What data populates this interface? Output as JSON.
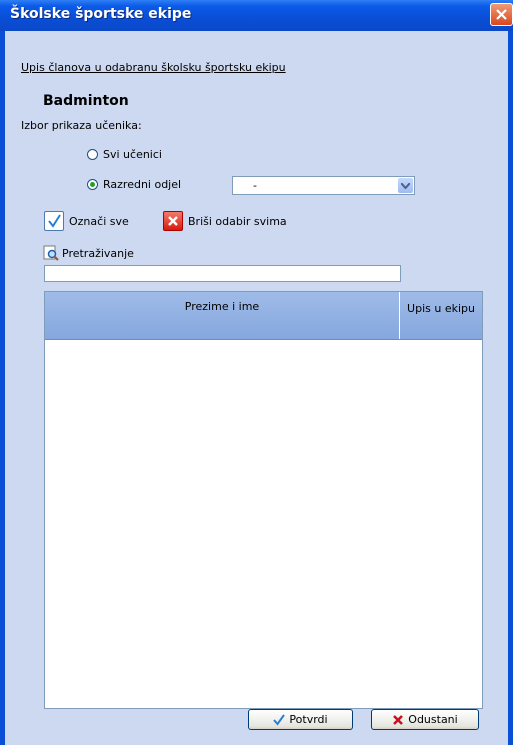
{
  "window": {
    "title": "Školske športske ekipe"
  },
  "form": {
    "heading": "Upis članova u odabranu školsku športsku ekipu",
    "sport": "Badminton",
    "view_label": "Izbor prikaza učenika:",
    "radio_all": "Svi učenici",
    "radio_class": "Razredni odjel",
    "class_select_value": "-",
    "select_all": "Označi sve",
    "clear_all": "Briši odabir svima",
    "search_label": "Pretraživanje",
    "search_value": ""
  },
  "table": {
    "columns": [
      "Prezime i ime",
      "Upis u ekipu"
    ],
    "rows": []
  },
  "buttons": {
    "confirm": "Potvrdi",
    "cancel": "Odustani"
  },
  "colors": {
    "titlebar": "#0a4ed6",
    "panel": "#ccd9f0",
    "header": "#95b4e6"
  }
}
